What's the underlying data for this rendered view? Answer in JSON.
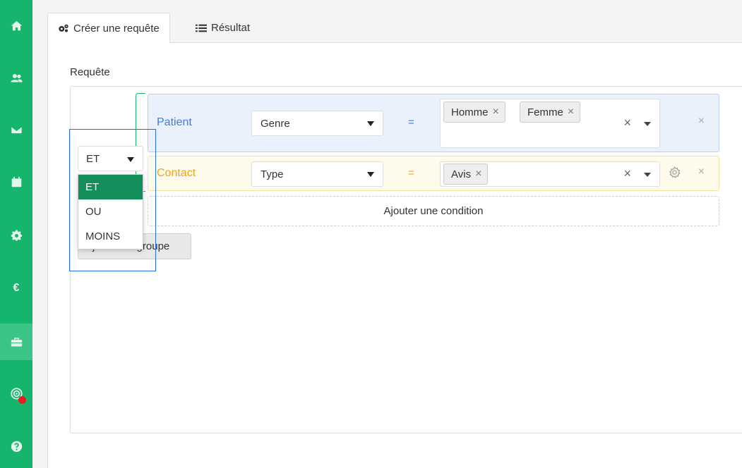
{
  "sidebar": {
    "items": [
      {
        "icon": "home-icon"
      },
      {
        "icon": "users-icon"
      },
      {
        "icon": "envelope-icon"
      },
      {
        "icon": "calendar-icon"
      },
      {
        "icon": "gear-icon"
      },
      {
        "icon": "euro-icon",
        "glyph": "€"
      },
      {
        "icon": "toolbox-icon",
        "active": true
      },
      {
        "icon": "radar-icon",
        "badge": true
      },
      {
        "icon": "help-icon"
      }
    ],
    "accent": "#16b56e"
  },
  "tabs": [
    {
      "label": "Créer une requête",
      "icon": "cogs-icon",
      "active": true
    },
    {
      "label": "Résultat",
      "icon": "list-icon",
      "active": false
    }
  ],
  "query": {
    "label": "Requête",
    "operator": {
      "selected": "ET",
      "options": [
        "ET",
        "OU",
        "MOINS"
      ]
    },
    "rules": [
      {
        "entity": "Patient",
        "field": "Genre",
        "operator": "=",
        "values": [
          "Homme",
          "Femme"
        ],
        "color": "#3f7ce3"
      },
      {
        "entity": "Contact",
        "field": "Type",
        "operator": "=",
        "values": [
          "Avis"
        ],
        "color": "#f0a21b"
      }
    ],
    "add_condition_label": "Ajouter une condition",
    "add_group_label": "Ajouter un groupe"
  }
}
